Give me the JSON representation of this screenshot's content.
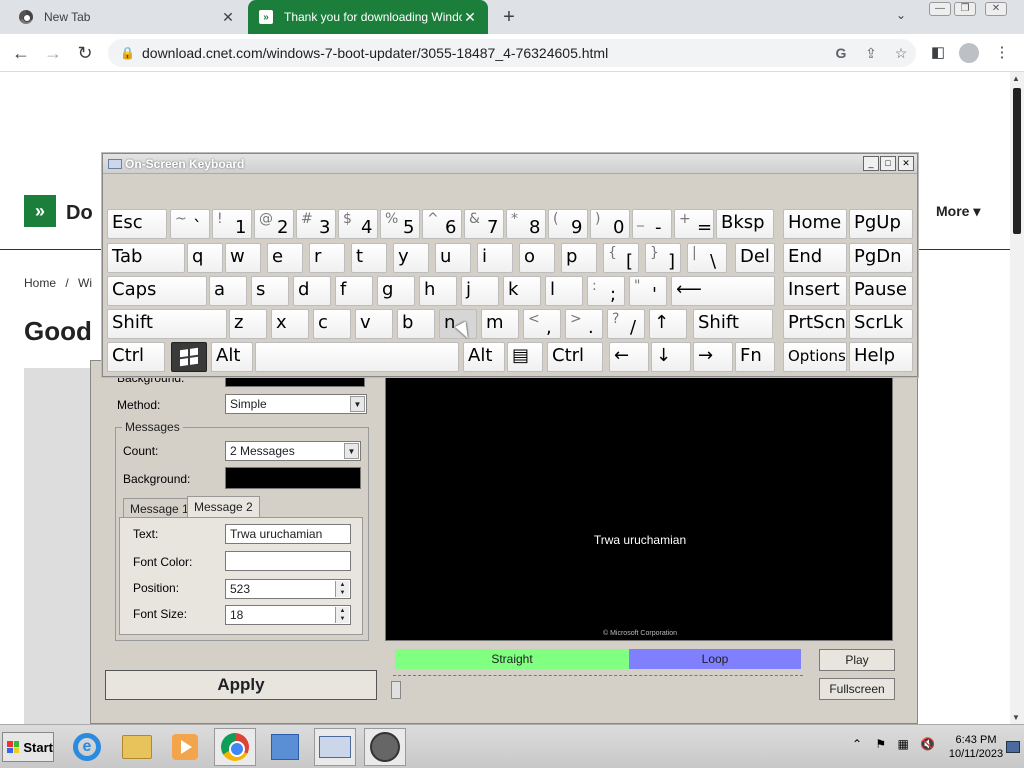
{
  "browser": {
    "tabs": [
      {
        "title": "New Tab",
        "icon": "chrome-icon"
      },
      {
        "title": "Thank you for downloading Window",
        "icon": "cnet-icon"
      }
    ],
    "url": "download.cnet.com/windows-7-boot-updater/3055-18487_4-76324605.html"
  },
  "page": {
    "nav_more": "More",
    "breadcrumb_home": "Home",
    "breadcrumb_sep": "/",
    "breadcrumb_next": "Wi",
    "brand_partial": "Do",
    "title_partial": "Good"
  },
  "app": {
    "background_label": "Background:",
    "method_label": "Method:",
    "method_value": "Simple",
    "messages_group": "Messages",
    "count_label": "Count:",
    "count_value": "2 Messages",
    "msg_background_label": "Background:",
    "tab1": "Message 1",
    "tab2": "Message 2",
    "text_label": "Text:",
    "text_value": "Trwa uruchamian",
    "font_color_label": "Font Color:",
    "position_label": "Position:",
    "position_value": "523",
    "font_size_label": "Font Size:",
    "font_size_value": "18",
    "preview_text": "Trwa uruchamian",
    "preview_copyright": "© Microsoft Corporation",
    "straight_label": "Straight",
    "loop_label": "Loop",
    "play_label": "Play",
    "fullscreen_label": "Fullscreen",
    "apply_label": "Apply",
    "colors": {
      "straight": "#80ff80",
      "loop": "#8080ff"
    }
  },
  "osk": {
    "title": "On-Screen Keyboard",
    "rows": [
      [
        {
          "up": "",
          "dn": "Esc"
        },
        {
          "up": "~",
          "dn": "`"
        },
        {
          "up": "!",
          "dn": "1"
        },
        {
          "up": "@",
          "dn": "2"
        },
        {
          "up": "#",
          "dn": "3"
        },
        {
          "up": "$",
          "dn": "4"
        },
        {
          "up": "%",
          "dn": "5"
        },
        {
          "up": "^",
          "dn": "6"
        },
        {
          "up": "&",
          "dn": "7"
        },
        {
          "up": "*",
          "dn": "8"
        },
        {
          "up": "(",
          "dn": "9"
        },
        {
          "up": ")",
          "dn": "0"
        },
        {
          "up": "_",
          "dn": "-"
        },
        {
          "up": "+",
          "dn": "="
        },
        {
          "up": "",
          "dn": "Bksp"
        },
        {
          "up": "",
          "dn": "Home"
        },
        {
          "up": "",
          "dn": "PgUp"
        }
      ],
      [
        {
          "up": "",
          "dn": "Tab"
        },
        {
          "up": "",
          "dn": "q"
        },
        {
          "up": "",
          "dn": "w"
        },
        {
          "up": "",
          "dn": "e"
        },
        {
          "up": "",
          "dn": "r"
        },
        {
          "up": "",
          "dn": "t"
        },
        {
          "up": "",
          "dn": "y"
        },
        {
          "up": "",
          "dn": "u"
        },
        {
          "up": "",
          "dn": "i"
        },
        {
          "up": "",
          "dn": "o"
        },
        {
          "up": "",
          "dn": "p"
        },
        {
          "up": "{",
          "dn": "["
        },
        {
          "up": "}",
          "dn": "]"
        },
        {
          "up": "|",
          "dn": "\\"
        },
        {
          "up": "",
          "dn": "Del"
        },
        {
          "up": "",
          "dn": "End"
        },
        {
          "up": "",
          "dn": "PgDn"
        }
      ],
      [
        {
          "up": "",
          "dn": "Caps"
        },
        {
          "up": "",
          "dn": "a"
        },
        {
          "up": "",
          "dn": "s"
        },
        {
          "up": "",
          "dn": "d"
        },
        {
          "up": "",
          "dn": "f"
        },
        {
          "up": "",
          "dn": "g"
        },
        {
          "up": "",
          "dn": "h"
        },
        {
          "up": "",
          "dn": "j"
        },
        {
          "up": "",
          "dn": "k"
        },
        {
          "up": "",
          "dn": "l"
        },
        {
          "up": ":",
          "dn": ";"
        },
        {
          "up": "\"",
          "dn": "'"
        },
        {
          "up": "",
          "dn": "⟵"
        },
        {
          "up": "",
          "dn": "Insert"
        },
        {
          "up": "",
          "dn": "Pause"
        }
      ],
      [
        {
          "up": "",
          "dn": "Shift"
        },
        {
          "up": "",
          "dn": "z"
        },
        {
          "up": "",
          "dn": "x"
        },
        {
          "up": "",
          "dn": "c"
        },
        {
          "up": "",
          "dn": "v"
        },
        {
          "up": "",
          "dn": "b"
        },
        {
          "up": "",
          "dn": "n"
        },
        {
          "up": "",
          "dn": "m"
        },
        {
          "up": "<",
          "dn": ","
        },
        {
          "up": ">",
          "dn": "."
        },
        {
          "up": "?",
          "dn": "/"
        },
        {
          "up": "",
          "dn": "↑"
        },
        {
          "up": "",
          "dn": "Shift"
        },
        {
          "up": "",
          "dn": "PrtScn"
        },
        {
          "up": "",
          "dn": "ScrLk"
        }
      ],
      [
        {
          "up": "",
          "dn": "Ctrl"
        },
        {
          "up": "",
          "dn": ""
        },
        {
          "up": "",
          "dn": "Alt"
        },
        {
          "up": "",
          "dn": ""
        },
        {
          "up": "",
          "dn": "Alt"
        },
        {
          "up": "",
          "dn": "▤"
        },
        {
          "up": "",
          "dn": "Ctrl"
        },
        {
          "up": "",
          "dn": "←"
        },
        {
          "up": "",
          "dn": "↓"
        },
        {
          "up": "",
          "dn": "→"
        },
        {
          "up": "",
          "dn": "Fn"
        },
        {
          "up": "",
          "dn": "Options"
        },
        {
          "up": "",
          "dn": "Help"
        }
      ]
    ]
  },
  "taskbar": {
    "start_label": "Start",
    "time": "6:43 PM",
    "date": "10/11/2023"
  }
}
